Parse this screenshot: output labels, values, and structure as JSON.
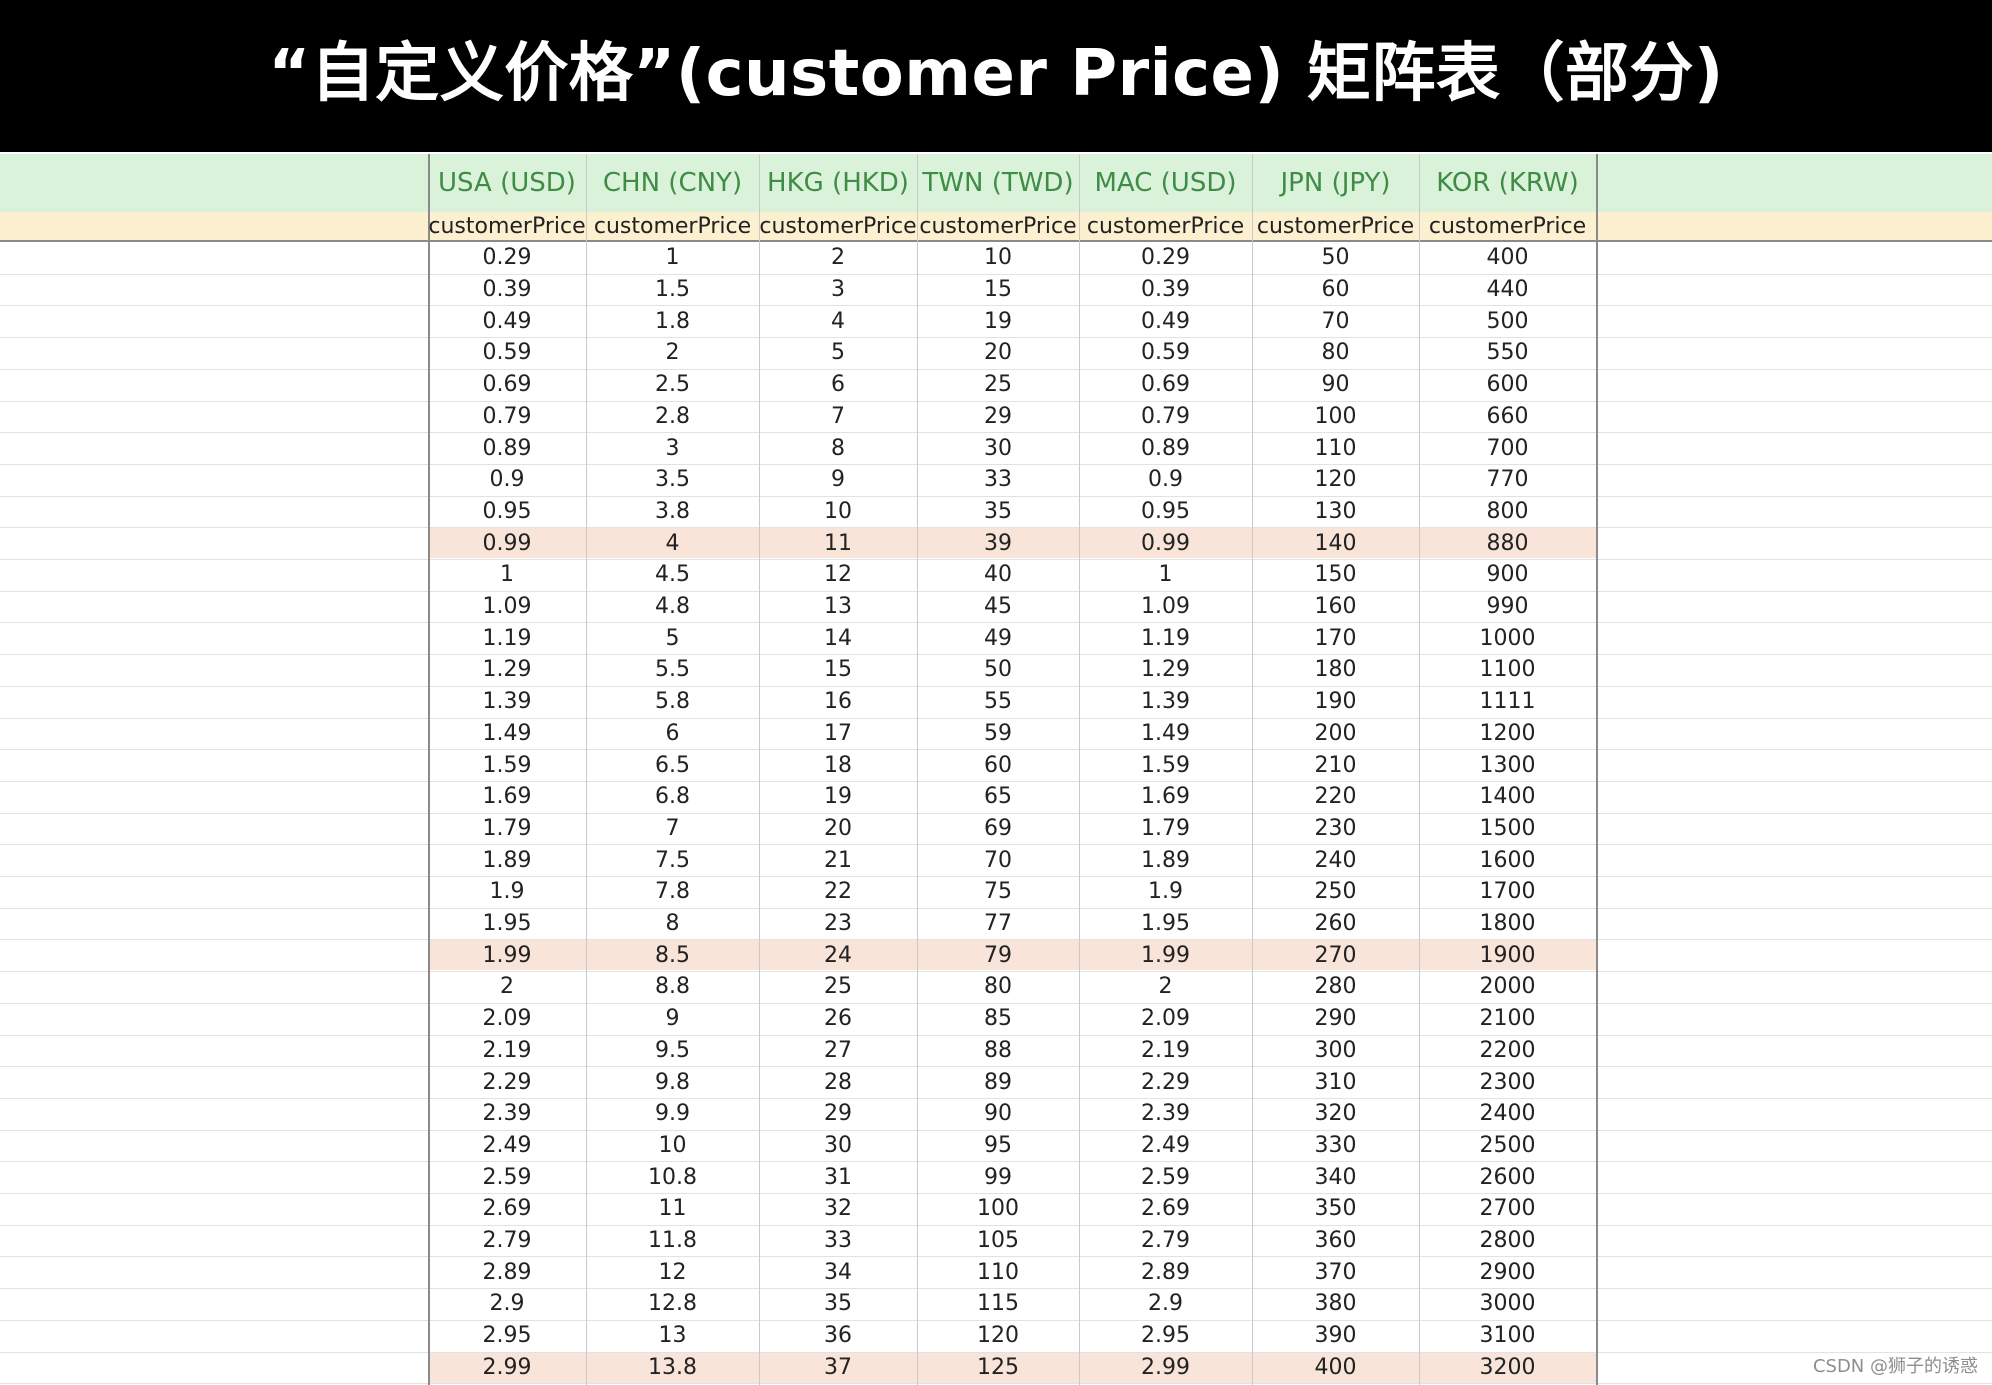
{
  "title": "“自定义价格”(customer Price) 矩阵表（部分)",
  "columns": [
    {
      "country": "USA (USD)",
      "field": "customerPrice"
    },
    {
      "country": "CHN (CNY)",
      "field": "customerPrice"
    },
    {
      "country": "HKG (HKD)",
      "field": "customerPrice"
    },
    {
      "country": "TWN (TWD)",
      "field": "customerPrice"
    },
    {
      "country": "MAC (USD)",
      "field": "customerPrice"
    },
    {
      "country": "JPN (JPY)",
      "field": "customerPrice"
    },
    {
      "country": "KOR (KRW)",
      "field": "customerPrice"
    }
  ],
  "rows": [
    [
      "0.29",
      "1",
      "2",
      "10",
      "0.29",
      "50",
      "400"
    ],
    [
      "0.39",
      "1.5",
      "3",
      "15",
      "0.39",
      "60",
      "440"
    ],
    [
      "0.49",
      "1.8",
      "4",
      "19",
      "0.49",
      "70",
      "500"
    ],
    [
      "0.59",
      "2",
      "5",
      "20",
      "0.59",
      "80",
      "550"
    ],
    [
      "0.69",
      "2.5",
      "6",
      "25",
      "0.69",
      "90",
      "600"
    ],
    [
      "0.79",
      "2.8",
      "7",
      "29",
      "0.79",
      "100",
      "660"
    ],
    [
      "0.89",
      "3",
      "8",
      "30",
      "0.89",
      "110",
      "700"
    ],
    [
      "0.9",
      "3.5",
      "9",
      "33",
      "0.9",
      "120",
      "770"
    ],
    [
      "0.95",
      "3.8",
      "10",
      "35",
      "0.95",
      "130",
      "800"
    ],
    [
      "0.99",
      "4",
      "11",
      "39",
      "0.99",
      "140",
      "880"
    ],
    [
      "1",
      "4.5",
      "12",
      "40",
      "1",
      "150",
      "900"
    ],
    [
      "1.09",
      "4.8",
      "13",
      "45",
      "1.09",
      "160",
      "990"
    ],
    [
      "1.19",
      "5",
      "14",
      "49",
      "1.19",
      "170",
      "1000"
    ],
    [
      "1.29",
      "5.5",
      "15",
      "50",
      "1.29",
      "180",
      "1100"
    ],
    [
      "1.39",
      "5.8",
      "16",
      "55",
      "1.39",
      "190",
      "1111"
    ],
    [
      "1.49",
      "6",
      "17",
      "59",
      "1.49",
      "200",
      "1200"
    ],
    [
      "1.59",
      "6.5",
      "18",
      "60",
      "1.59",
      "210",
      "1300"
    ],
    [
      "1.69",
      "6.8",
      "19",
      "65",
      "1.69",
      "220",
      "1400"
    ],
    [
      "1.79",
      "7",
      "20",
      "69",
      "1.79",
      "230",
      "1500"
    ],
    [
      "1.89",
      "7.5",
      "21",
      "70",
      "1.89",
      "240",
      "1600"
    ],
    [
      "1.9",
      "7.8",
      "22",
      "75",
      "1.9",
      "250",
      "1700"
    ],
    [
      "1.95",
      "8",
      "23",
      "77",
      "1.95",
      "260",
      "1800"
    ],
    [
      "1.99",
      "8.5",
      "24",
      "79",
      "1.99",
      "270",
      "1900"
    ],
    [
      "2",
      "8.8",
      "25",
      "80",
      "2",
      "280",
      "2000"
    ],
    [
      "2.09",
      "9",
      "26",
      "85",
      "2.09",
      "290",
      "2100"
    ],
    [
      "2.19",
      "9.5",
      "27",
      "88",
      "2.19",
      "300",
      "2200"
    ],
    [
      "2.29",
      "9.8",
      "28",
      "89",
      "2.29",
      "310",
      "2300"
    ],
    [
      "2.39",
      "9.9",
      "29",
      "90",
      "2.39",
      "320",
      "2400"
    ],
    [
      "2.49",
      "10",
      "30",
      "95",
      "2.49",
      "330",
      "2500"
    ],
    [
      "2.59",
      "10.8",
      "31",
      "99",
      "2.59",
      "340",
      "2600"
    ],
    [
      "2.69",
      "11",
      "32",
      "100",
      "2.69",
      "350",
      "2700"
    ],
    [
      "2.79",
      "11.8",
      "33",
      "105",
      "2.79",
      "360",
      "2800"
    ],
    [
      "2.89",
      "12",
      "34",
      "110",
      "2.89",
      "370",
      "2900"
    ],
    [
      "2.9",
      "12.8",
      "35",
      "115",
      "2.9",
      "380",
      "3000"
    ],
    [
      "2.95",
      "13",
      "36",
      "120",
      "2.95",
      "390",
      "3100"
    ],
    [
      "2.99",
      "13.8",
      "37",
      "125",
      "2.99",
      "400",
      "3200"
    ]
  ],
  "highlighted_rows": [
    9,
    22,
    35
  ],
  "colors": {
    "header_green": "#d9f2d9",
    "header_text_green": "#3f8c47",
    "field_row_yellow": "#fdf0d0",
    "highlight_row": "#f8e4d8"
  },
  "watermark": "CSDN @狮子的诱惑"
}
